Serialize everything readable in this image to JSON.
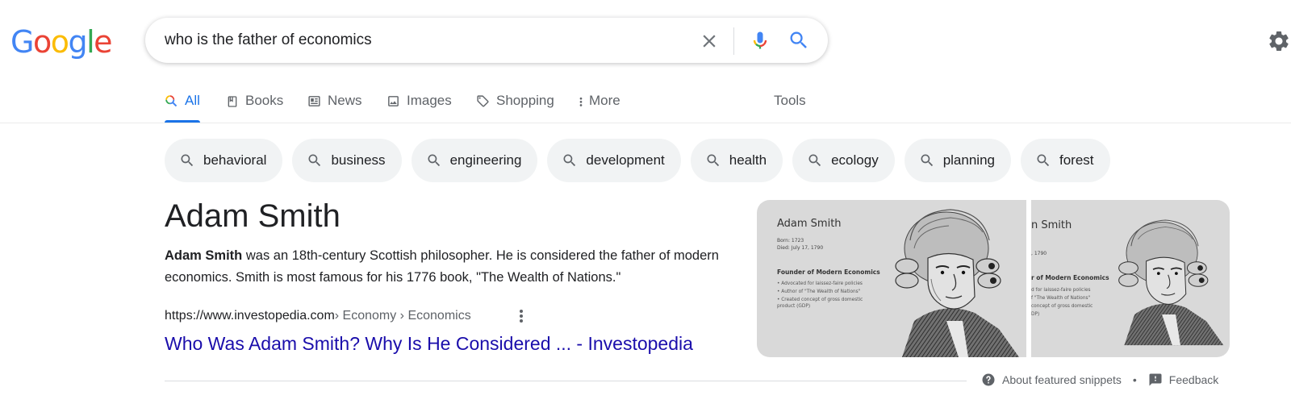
{
  "logo": {
    "letters": [
      "G",
      "o",
      "o",
      "g",
      "l",
      "e"
    ],
    "colors": [
      "#4285f4",
      "#ea4335",
      "#fbbc05",
      "#4285f4",
      "#34a853",
      "#ea4335"
    ]
  },
  "search": {
    "value": "who is the father of economics"
  },
  "tabs": [
    {
      "label": "All",
      "icon": "search-multicolor-icon",
      "active": true
    },
    {
      "label": "Books",
      "icon": "book-icon"
    },
    {
      "label": "News",
      "icon": "newspaper-icon"
    },
    {
      "label": "Images",
      "icon": "image-icon"
    },
    {
      "label": "Shopping",
      "icon": "tag-icon"
    },
    {
      "label": "More",
      "icon": "more-vert-icon"
    },
    {
      "label": "Tools"
    }
  ],
  "chips": [
    {
      "label": "behavioral"
    },
    {
      "label": "business"
    },
    {
      "label": "engineering"
    },
    {
      "label": "development"
    },
    {
      "label": "health"
    },
    {
      "label": "ecology"
    },
    {
      "label": "planning"
    },
    {
      "label": "forest"
    }
  ],
  "answer": {
    "title": "Adam Smith",
    "bold": "Adam Smith",
    "text": " was an 18th-century Scottish philosopher. He is considered the father of modern economics. Smith is most famous for his 1776 book, \"The Wealth of Nations.\"",
    "cite_url": "https://www.investopedia.com",
    "cite_crumbs": " › Economy › Economics",
    "link": "Who Was Adam Smith? Why Is He Considered ... - Investopedia"
  },
  "images": {
    "panel1": {
      "name": "Adam Smith",
      "born": "Born: 1723",
      "died": "Died: July 17, 1790",
      "heading": "Founder of Modern Economics",
      "items": [
        "• Advocated for laissez-faire policies",
        "• Author of \"The Wealth of Nations\"",
        "• Created concept of gross domestic",
        "  product (GDP)"
      ]
    },
    "panel2": {
      "name": "n Smith",
      "died": ", 1790",
      "heading": "r of Modern Economics",
      "items": [
        "d for laissez-faire policies",
        "f \"The Wealth of Nations\"",
        "concept of gross domestic",
        "DP)"
      ]
    }
  },
  "footer": {
    "about": "About featured snippets",
    "separator": "•",
    "feedback": "Feedback"
  },
  "colors": {
    "accent": "#1a73e8",
    "link": "#1a0dab",
    "chip_bg": "#f1f3f4"
  }
}
